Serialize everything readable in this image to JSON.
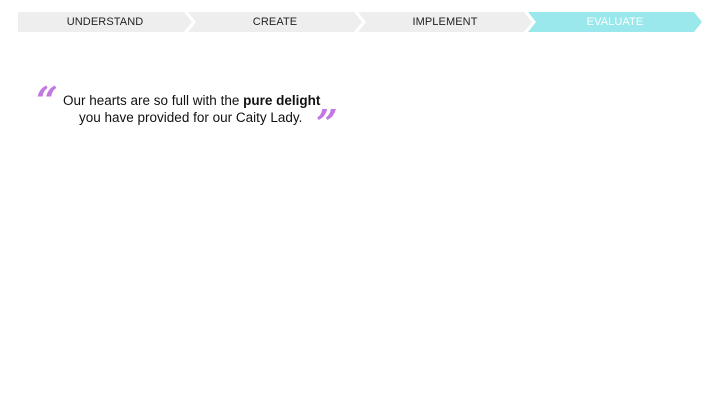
{
  "stepper": {
    "steps": [
      {
        "label": "UNDERSTAND",
        "active": false
      },
      {
        "label": "CREATE",
        "active": false
      },
      {
        "label": "IMPLEMENT",
        "active": false
      },
      {
        "label": "EVALUATE",
        "active": true
      }
    ],
    "colors": {
      "inactive": "#eeeeee",
      "active": "#9ae8ec",
      "active_text": "#ffffff"
    }
  },
  "quote": {
    "open_mark": "“",
    "close_mark": "”",
    "line1_prefix": "Our hearts are so full with the ",
    "line1_bold": "pure delight",
    "line2": "you have provided for our Caity Lady.",
    "mark_color": "#c377e0"
  }
}
